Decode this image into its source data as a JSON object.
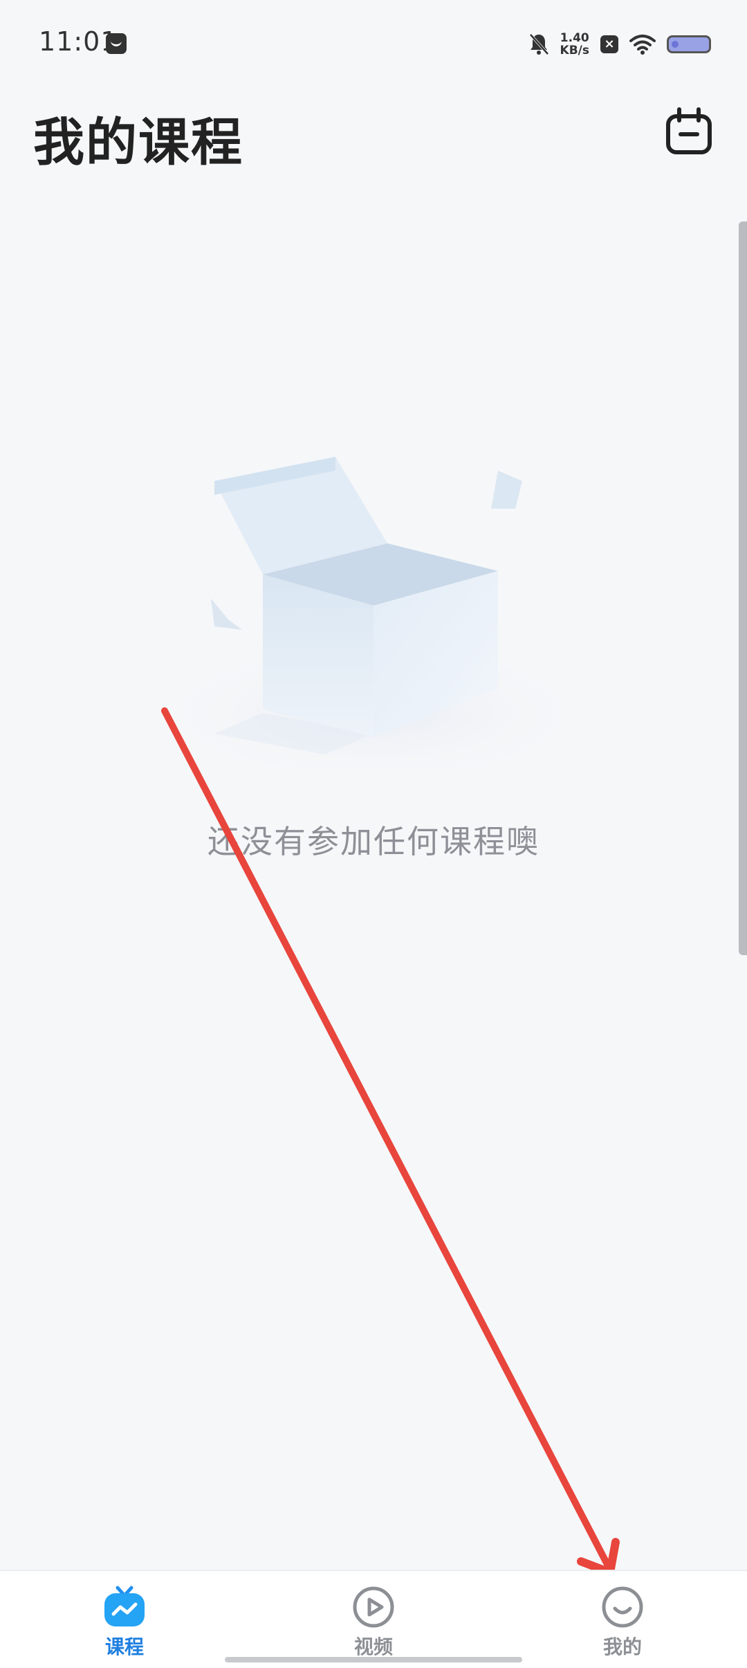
{
  "status_bar": {
    "time": "11:01",
    "net_speed_value": "1.40",
    "net_speed_unit": "KB/s",
    "icons": [
      "message-icon",
      "mute-bell-icon",
      "x-badge-icon",
      "wifi-icon",
      "battery-icon"
    ]
  },
  "header": {
    "title": "我的课程",
    "action_icon": "calendar-icon"
  },
  "empty_state": {
    "message": "还没有参加任何课程噢",
    "illustration": "open-box-icon"
  },
  "tab_bar": {
    "tabs": [
      {
        "label": "课程",
        "icon": "course-tv-icon",
        "active": true
      },
      {
        "label": "视频",
        "icon": "play-circle-icon",
        "active": false
      },
      {
        "label": "我的",
        "icon": "smile-face-icon",
        "active": false
      }
    ]
  },
  "colors": {
    "accent": "#1f7fe0",
    "background": "#f6f7f9",
    "inactive": "#8c8f94",
    "annotation": "#e8453c"
  }
}
